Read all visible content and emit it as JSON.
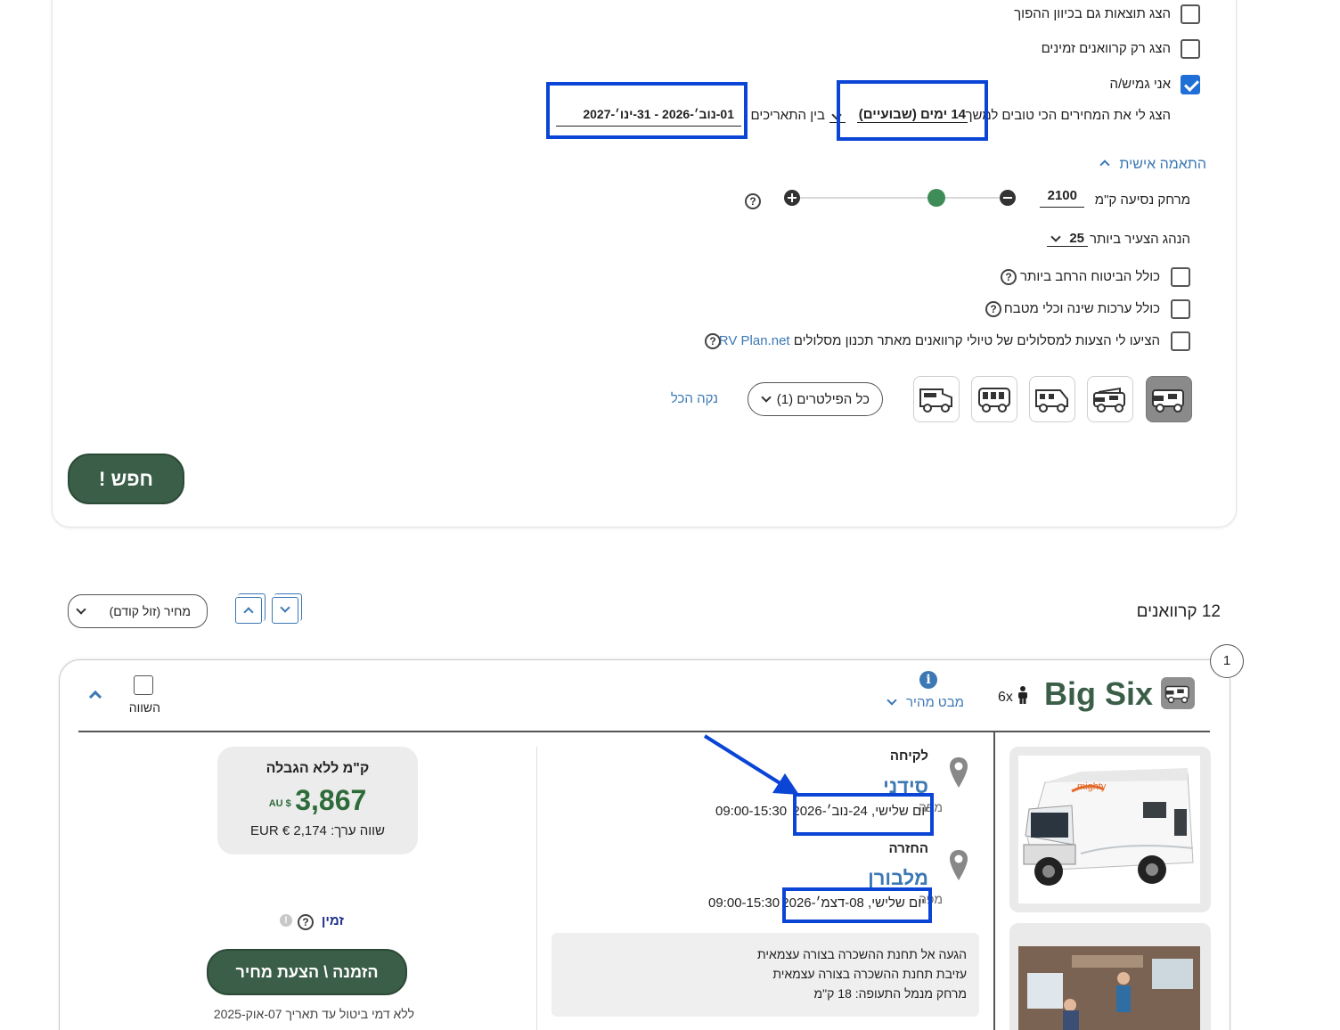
{
  "filters": {
    "reverse_direction_label": "הצג תוצאות גם בכיוון ההפוך",
    "available_only_label": "הצג רק קרוואנים זמינים",
    "flexible_label": "אני גמיש/ה",
    "best_prices_prefix": "הצג לי את המחירים הכי טובים למשך",
    "duration_value": "14 ימים (שבועיים)",
    "between_dates_label": "בין התאריכים",
    "date_range_value": "01-נוב׳-2026 - 31-ינו׳-2027",
    "personalize_label": "התאמה אישית",
    "distance_label": "מרחק נסיעה ק\"מ",
    "distance_value": "2100",
    "youngest_driver_label": "הנהג הצעיר ביותר",
    "youngest_driver_value": "25",
    "max_insurance_label": "כולל הביטוח הרחב ביותר",
    "bedding_kitchen_label": "כולל ערכות שינה וכלי מטבח",
    "rvplan_label": "הציעו לי הצעות למסלולים של טיולי קרוואנים מאתר תכנון מסלולים",
    "rvplan_link": "RV Plan.net",
    "all_filters_label": "כל הפילטרים (1)",
    "clear_all_label": "נקה הכל",
    "search_button": "חפש !"
  },
  "results": {
    "count_label": "12 קרוואנים",
    "sort_value": "מחיר (זול קודם)"
  },
  "vehicle": {
    "index": "1",
    "name": "Big Six",
    "passengers": "6x",
    "quick_view_label": "מבט מהיר",
    "compare_label": "השווה",
    "pickup_heading": "לקיחה",
    "pickup_city": "סידני",
    "pickup_date": "יום שלישי, 24-נוב׳-2026",
    "pickup_hours": "09:00-15:30",
    "return_heading": "החזרה",
    "return_city": "מלבורן",
    "return_date": "יום שלישי, 08-דצמ׳-2026",
    "return_hours": "09:00-15:30",
    "map_label": "מפה",
    "notes": [
      "הגעה אל תחנת ההשכרה בצורה עצמאית",
      "עזיבת תחנת ההשכרה בצורה עצמאית",
      "מרחק מנמל התעופה: 18 ק\"מ"
    ],
    "unlimited_km": "ק\"מ ללא הגבלה",
    "price": "3,867",
    "currency": "AU $",
    "equivalent": "שווה ערך: EUR € 2,174",
    "available_label": "זמין",
    "book_button": "הזמנה \\ הצעת מחיר",
    "free_cancel": "ללא דמי ביטול עד תאריך 07-אוק-2025"
  },
  "colors": {
    "accent_green": "#3b5e48",
    "highlight_blue": "#0a45d6",
    "link_blue": "#3c78b4",
    "price_green": "#2e6b3a"
  }
}
